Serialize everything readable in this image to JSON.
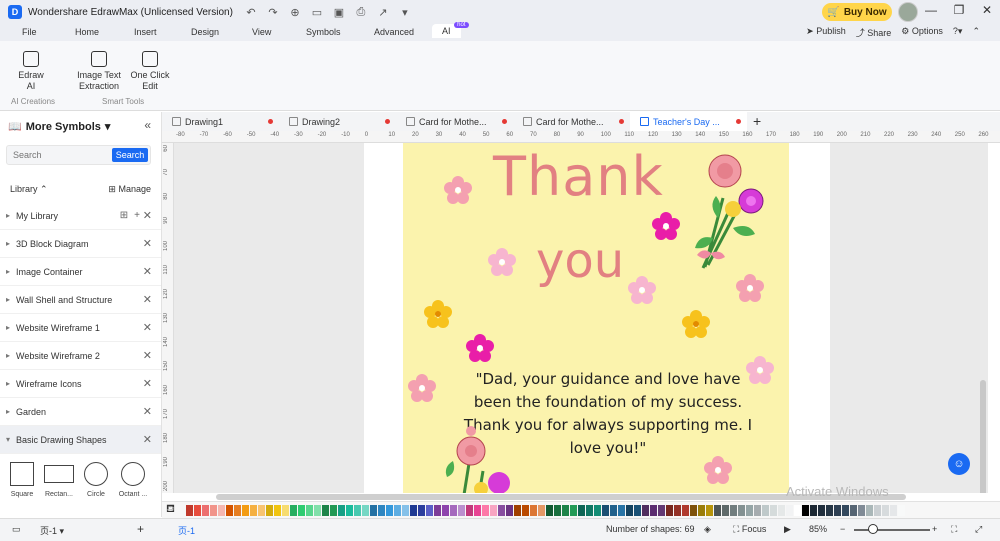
{
  "titlebar": {
    "app_title": "Wondershare EdrawMax (Unlicensed Version)",
    "buy_now": "Buy Now"
  },
  "menu": {
    "items": [
      "File",
      "Home",
      "Insert",
      "Design",
      "View",
      "Symbols",
      "Advanced",
      "AI"
    ],
    "hot_badge": "hot",
    "publish": "Publish",
    "share": "Share",
    "options": "Options"
  },
  "ribbon": {
    "edraw_ai": "Edraw AI",
    "image_text_extraction": "Image Text Extraction",
    "one_click_edit": "One Click Edit",
    "ai_creations_label": "AI Creations",
    "smart_tools_label": "Smart Tools"
  },
  "left_panel": {
    "title": "More Symbols",
    "search_placeholder": "Search",
    "search_button": "Search",
    "library_label": "Library",
    "manage": "Manage",
    "items": [
      "My Library",
      "3D Block Diagram",
      "Image Container",
      "Wall Shell and Structure",
      "Website Wireframe 1",
      "Website Wireframe 2",
      "Wireframe Icons",
      "Garden",
      "Basic Drawing Shapes"
    ],
    "shapes": [
      "Square",
      "Rectan...",
      "Circle",
      "Octant ..."
    ]
  },
  "doc_tabs": [
    "Drawing1",
    "Drawing2",
    "Card for Mothe...",
    "Card for Mothe...",
    "Teacher's Day ..."
  ],
  "ruler": {
    "h": [
      "-80",
      "-70",
      "-60",
      "-50",
      "-40",
      "-30",
      "-20",
      "-10",
      "0",
      "10",
      "20",
      "30",
      "40",
      "50",
      "60",
      "70",
      "80",
      "90",
      "100",
      "110",
      "120",
      "130",
      "140",
      "150",
      "160",
      "170",
      "180",
      "190",
      "200",
      "210",
      "220",
      "230",
      "240",
      "250",
      "260"
    ],
    "v": [
      "60",
      "70",
      "80",
      "90",
      "100",
      "110",
      "120",
      "130",
      "140",
      "150",
      "160",
      "170",
      "180",
      "190",
      "200"
    ]
  },
  "card": {
    "line1": "Thank",
    "line2": "you",
    "quote": "\"Dad, your guidance and love have been the foundation of my success. Thank you for always supporting me. I love you!\""
  },
  "watermark": "Activate Windows",
  "palette": [
    "#c0392b",
    "#e74c3c",
    "#ec6f6f",
    "#f1948a",
    "#f5b7b1",
    "#d35400",
    "#e67e22",
    "#f39c12",
    "#f5b041",
    "#f8c471",
    "#d4ac0d",
    "#f1c40f",
    "#f7dc6f",
    "#27ae60",
    "#2ecc71",
    "#58d68d",
    "#82e0aa",
    "#1e8449",
    "#229954",
    "#16a085",
    "#1abc9c",
    "#48c9b0",
    "#76d7c4",
    "#2471a3",
    "#2e86c1",
    "#3498db",
    "#5dade2",
    "#85c1e9",
    "#1f3a93",
    "#2c3e9e",
    "#5b5fc7",
    "#7d3c98",
    "#8e44ad",
    "#a569bd",
    "#bb8fce",
    "#c0397b",
    "#e84393",
    "#fd79a8",
    "#f8a5c2",
    "#884ea0",
    "#6c3483",
    "#a04000",
    "#ba4a00",
    "#dc7633",
    "#e59866",
    "#145a32",
    "#196f3d",
    "#1d8348",
    "#239b56",
    "#0e6655",
    "#117864",
    "#138d75",
    "#1b4f72",
    "#21618c",
    "#2874a6",
    "#154360",
    "#1a5276",
    "#512e5f",
    "#5b2c6f",
    "#633974",
    "#78281f",
    "#943126",
    "#b03a2e",
    "#7e5109",
    "#9a7d0a",
    "#b7950b",
    "#4d5656",
    "#5f6a6a",
    "#717d7e",
    "#839192",
    "#95a5a6",
    "#a6acaf",
    "#bfc9ca",
    "#d5dbdb",
    "#e5e8e8",
    "#f2f3f4",
    "#ffffff",
    "#000000",
    "#1c2833",
    "#212f3d",
    "#273746",
    "#2e4053",
    "#34495e",
    "#566573",
    "#808b96",
    "#aab7b8",
    "#cacfd2",
    "#d7dbdd",
    "#e5e7e9",
    "#f8f9f9"
  ],
  "status": {
    "page": "页-1",
    "page_tab": "页-1",
    "shapes_count": "Number of shapes: 69",
    "focus": "Focus",
    "zoom": "85%"
  }
}
